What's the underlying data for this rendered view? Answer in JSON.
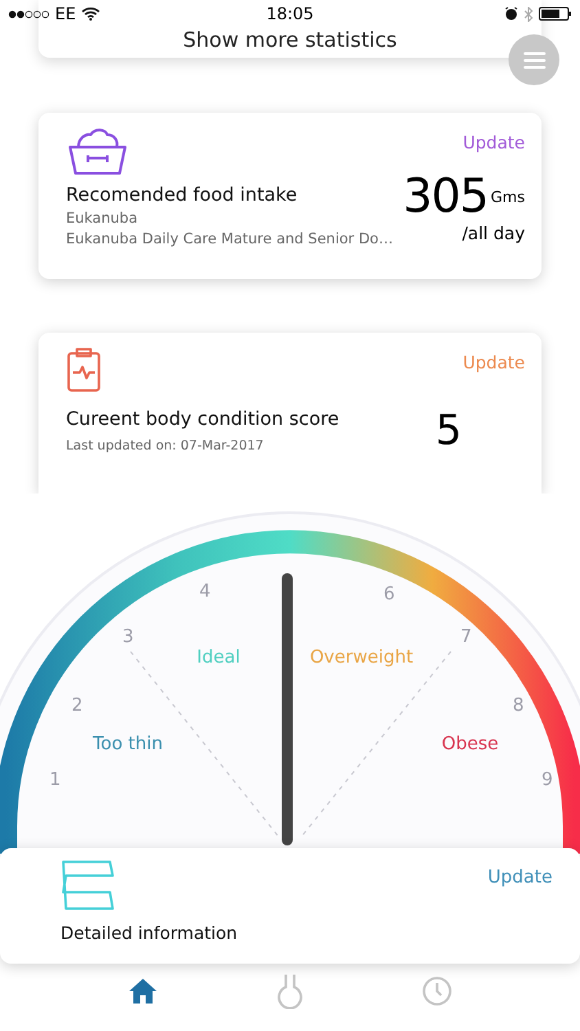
{
  "status_bar": {
    "carrier": "EE",
    "time": "18:05"
  },
  "stats_button": {
    "label": "Show more statistics"
  },
  "food_card": {
    "action": "Update",
    "title": "Recomended food intake",
    "brand": "Eukanuba",
    "product": "Eukanuba Daily Care Mature and Senior Do…",
    "amount": "305",
    "unit": "Gms",
    "period": "/all day"
  },
  "condition_card": {
    "action": "Update",
    "title": "Cureent body condition score",
    "updated": "Last updated on: 07-Mar-2017",
    "score": "5"
  },
  "gauge": {
    "scale": [
      "1",
      "2",
      "3",
      "4",
      "6",
      "7",
      "8",
      "9"
    ],
    "zones": [
      {
        "label": "Too thin",
        "color": "#3a8fae"
      },
      {
        "label": "Ideal",
        "color": "#4fcfc0"
      },
      {
        "label": "Overweight",
        "color": "#e9a545"
      },
      {
        "label": "Obese",
        "color": "#d8344f"
      }
    ]
  },
  "detail_card": {
    "action": "Update",
    "title": "Detailed information"
  },
  "tab_bar": [
    {
      "kind": "home",
      "selected": true
    },
    {
      "kind": "flask",
      "selected": false
    },
    {
      "kind": "clock",
      "selected": false
    }
  ]
}
